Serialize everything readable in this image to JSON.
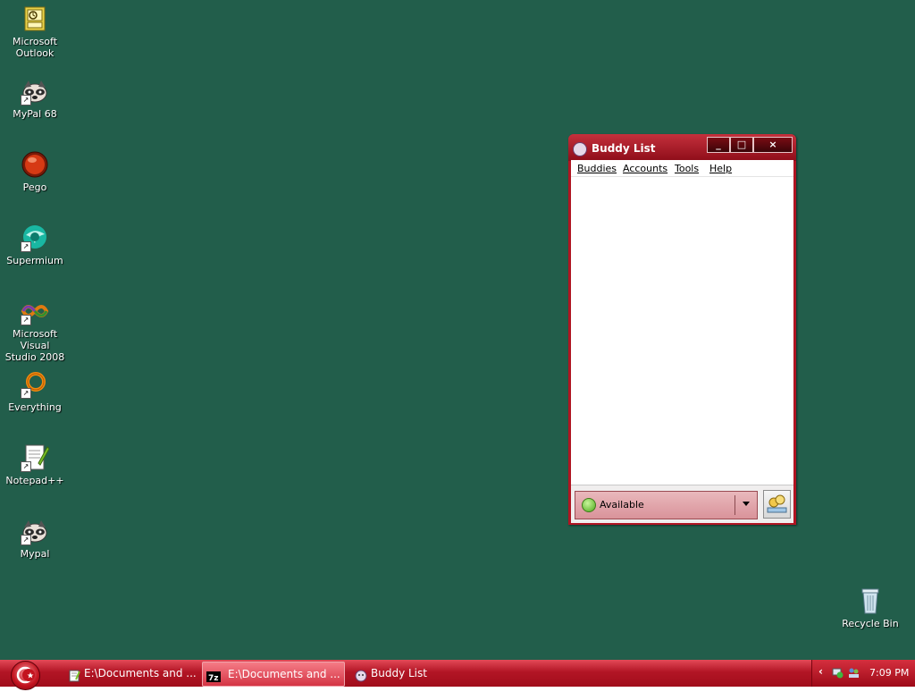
{
  "desktop": {
    "icons": [
      {
        "label_line1": "Microsoft",
        "label_line2": "Outlook",
        "icon": "outlook-icon"
      },
      {
        "label_line1": "MyPal 68",
        "label_line2": "",
        "icon": "raccoon-icon"
      },
      {
        "label_line1": "Pego",
        "label_line2": "",
        "icon": "pego-orb-icon"
      },
      {
        "label_line1": "Supermium",
        "label_line2": "",
        "icon": "supermium-icon"
      },
      {
        "label_line1": "Microsoft Visual",
        "label_line2": "Studio 2008",
        "icon": "visual-studio-icon"
      },
      {
        "label_line1": "Everything",
        "label_line2": "",
        "icon": "everything-search-icon"
      },
      {
        "label_line1": "Notepad++",
        "label_line2": "",
        "icon": "notepad-plus-plus-icon"
      },
      {
        "label_line1": "Mypal",
        "label_line2": "",
        "icon": "raccoon-icon"
      }
    ],
    "recycle_bin": {
      "label": "Recycle Bin",
      "icon": "recycle-bin-icon"
    },
    "background_color": "#225e4b"
  },
  "buddy_window": {
    "title": "Buddy List",
    "controls": {
      "minimize": "_",
      "maximize": "□",
      "close": "×"
    },
    "menu": [
      "Buddies",
      "Accounts",
      "Tools",
      "Help"
    ],
    "status": {
      "label": "Available",
      "led_color": "#4caa1c"
    },
    "accent_color": "#b01522"
  },
  "taskbar": {
    "tasks": [
      {
        "label": "E:\\Documents and ...",
        "icon": "notepad-icon",
        "active": false
      },
      {
        "label": "E:\\Documents and ...",
        "icon": "7zip-icon",
        "active": true
      },
      {
        "label": "Buddy List",
        "icon": "pidgin-icon",
        "active": false
      }
    ],
    "clock": "7:09 PM",
    "tray_icons": [
      "network-icon",
      "users-icon"
    ]
  }
}
